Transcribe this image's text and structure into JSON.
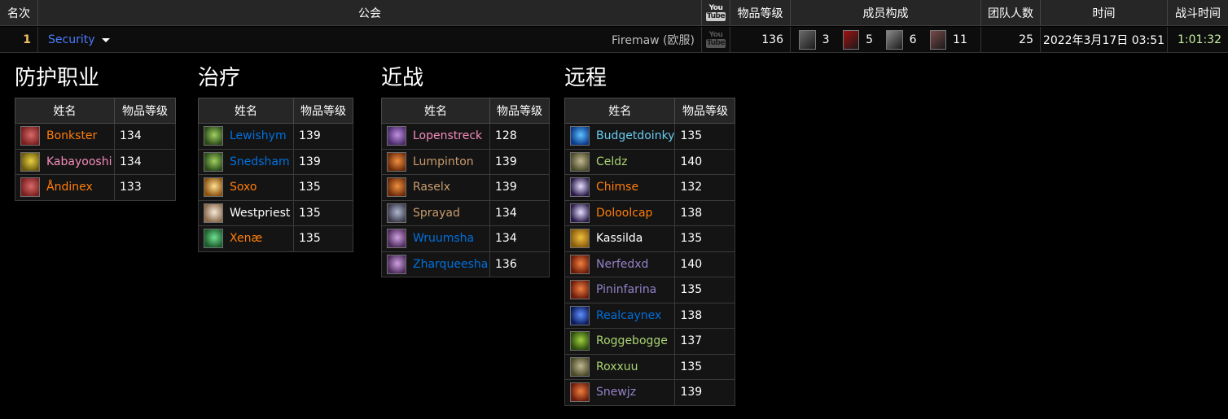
{
  "header": {
    "rank": "名次",
    "guild": "公会",
    "video_you": "You",
    "video_tube": "Tube",
    "item_level": "物品等级",
    "composition": "成员构成",
    "raid_size": "团队人数",
    "time": "时间",
    "duration": "战斗时间"
  },
  "row": {
    "rank": "1",
    "guild_name": "Security",
    "server": "Firemaw (欧服)",
    "item_level": "136",
    "composition": [
      {
        "icon": "tank-role-icon",
        "count": "3",
        "color": "#6b6b6b"
      },
      {
        "icon": "healer-heart-icon",
        "count": "5",
        "color": "#a01010"
      },
      {
        "icon": "melee-sword-icon",
        "count": "6",
        "color": "#8a8a8a"
      },
      {
        "icon": "ranged-bow-icon",
        "count": "11",
        "color": "#7a4a4a"
      }
    ],
    "raid_size": "25",
    "time": "2022年3月17日 03:51",
    "duration": "1:01:32"
  },
  "colors": {
    "guild_link": "#4a7dff",
    "rank": "#f0c060",
    "duration": "#c8f0a0"
  },
  "columns": {
    "name": "姓名",
    "ilvl": "物品等级"
  },
  "sections": [
    {
      "title": "防护职业",
      "players": [
        {
          "name": "Bonkster",
          "ilvl": "134",
          "color": "#ff7d0a",
          "icon": "bear-form-icon",
          "c1": "#7a1f1f",
          "c2": "#d86a6a"
        },
        {
          "name": "Kabayooshi",
          "ilvl": "134",
          "color": "#f58cba",
          "icon": "paladin-shield-icon",
          "c1": "#6a5a10",
          "c2": "#e8d040"
        },
        {
          "name": "Åndinex",
          "ilvl": "133",
          "color": "#ff7d0a",
          "icon": "bear-form-icon",
          "c1": "#7a1f1f",
          "c2": "#d86a6a"
        }
      ]
    },
    {
      "title": "治疗",
      "players": [
        {
          "name": "Lewishym",
          "ilvl": "139",
          "color": "#0070de",
          "icon": "shaman-totem-icon",
          "c1": "#2a4a1a",
          "c2": "#a0d060"
        },
        {
          "name": "Snedsham",
          "ilvl": "139",
          "color": "#0070de",
          "icon": "shaman-totem-icon",
          "c1": "#2a4a1a",
          "c2": "#a0d060"
        },
        {
          "name": "Soxo",
          "ilvl": "135",
          "color": "#ff7d0a",
          "icon": "holy-light-icon",
          "c1": "#8a5010",
          "c2": "#ffe090"
        },
        {
          "name": "Westpriest",
          "ilvl": "135",
          "color": "#ffffff",
          "icon": "priest-holy-icon",
          "c1": "#8a6a4a",
          "c2": "#f5e8d8"
        },
        {
          "name": "Xenæ",
          "ilvl": "135",
          "color": "#ff7d0a",
          "icon": "nature-leaf-icon",
          "c1": "#1a5a2a",
          "c2": "#70e090"
        }
      ]
    },
    {
      "title": "近战",
      "players": [
        {
          "name": "Lopenstreck",
          "ilvl": "128",
          "color": "#f58cba",
          "icon": "retribution-icon",
          "c1": "#4a2a6a",
          "c2": "#c090e0"
        },
        {
          "name": "Lumpinton",
          "ilvl": "139",
          "color": "#c79c6e",
          "icon": "warrior-fury-icon",
          "c1": "#6a2a0a",
          "c2": "#f09040"
        },
        {
          "name": "Raselx",
          "ilvl": "139",
          "color": "#c79c6e",
          "icon": "warrior-fury-icon",
          "c1": "#6a2a0a",
          "c2": "#f09040"
        },
        {
          "name": "Sprayad",
          "ilvl": "134",
          "color": "#c79c6e",
          "icon": "warrior-arms-icon",
          "c1": "#3a3a4a",
          "c2": "#b0b8d0"
        },
        {
          "name": "Wruumsha",
          "ilvl": "134",
          "color": "#0070de",
          "icon": "enhancement-icon",
          "c1": "#4a2a5a",
          "c2": "#d0a0e0"
        },
        {
          "name": "Zharqueesha",
          "ilvl": "136",
          "color": "#0070de",
          "icon": "enhancement-icon",
          "c1": "#4a2a5a",
          "c2": "#d0a0e0"
        }
      ]
    },
    {
      "title": "远程",
      "players": [
        {
          "name": "Budgetdoinky",
          "ilvl": "135",
          "color": "#69ccf0",
          "icon": "frost-mage-icon",
          "c1": "#0a3a8a",
          "c2": "#60c0ff"
        },
        {
          "name": "Celdz",
          "ilvl": "140",
          "color": "#abd473",
          "icon": "hunter-beast-icon",
          "c1": "#4a4a2a",
          "c2": "#c0b890"
        },
        {
          "name": "Chimse",
          "ilvl": "132",
          "color": "#ff7d0a",
          "icon": "moonfire-icon",
          "c1": "#2a1a4a",
          "c2": "#e8e0ff"
        },
        {
          "name": "Doloolcap",
          "ilvl": "138",
          "color": "#ff7d0a",
          "icon": "moonfire-icon",
          "c1": "#2a1a4a",
          "c2": "#e8e0ff"
        },
        {
          "name": "Kassilda",
          "ilvl": "135",
          "color": "#ffffff",
          "icon": "shadow-skull-icon",
          "c1": "#8a5a0a",
          "c2": "#f0c040"
        },
        {
          "name": "Nerfedxd",
          "ilvl": "140",
          "color": "#9482c9",
          "icon": "destruction-icon",
          "c1": "#6a1a0a",
          "c2": "#f08040"
        },
        {
          "name": "Pininfarina",
          "ilvl": "135",
          "color": "#9482c9",
          "icon": "destruction-icon",
          "c1": "#6a1a0a",
          "c2": "#f08040"
        },
        {
          "name": "Realcaynex",
          "ilvl": "138",
          "color": "#0070de",
          "icon": "lightning-icon",
          "c1": "#0a1a5a",
          "c2": "#6090ff"
        },
        {
          "name": "Roggebogge",
          "ilvl": "137",
          "color": "#abd473",
          "icon": "hunter-mark-icon",
          "c1": "#2a4a0a",
          "c2": "#a0d040"
        },
        {
          "name": "Roxxuu",
          "ilvl": "135",
          "color": "#abd473",
          "icon": "hunter-beast-icon",
          "c1": "#4a4a2a",
          "c2": "#c0b890"
        },
        {
          "name": "Snewjz",
          "ilvl": "139",
          "color": "#9482c9",
          "icon": "destruction-icon",
          "c1": "#6a1a0a",
          "c2": "#f08040"
        }
      ]
    }
  ]
}
